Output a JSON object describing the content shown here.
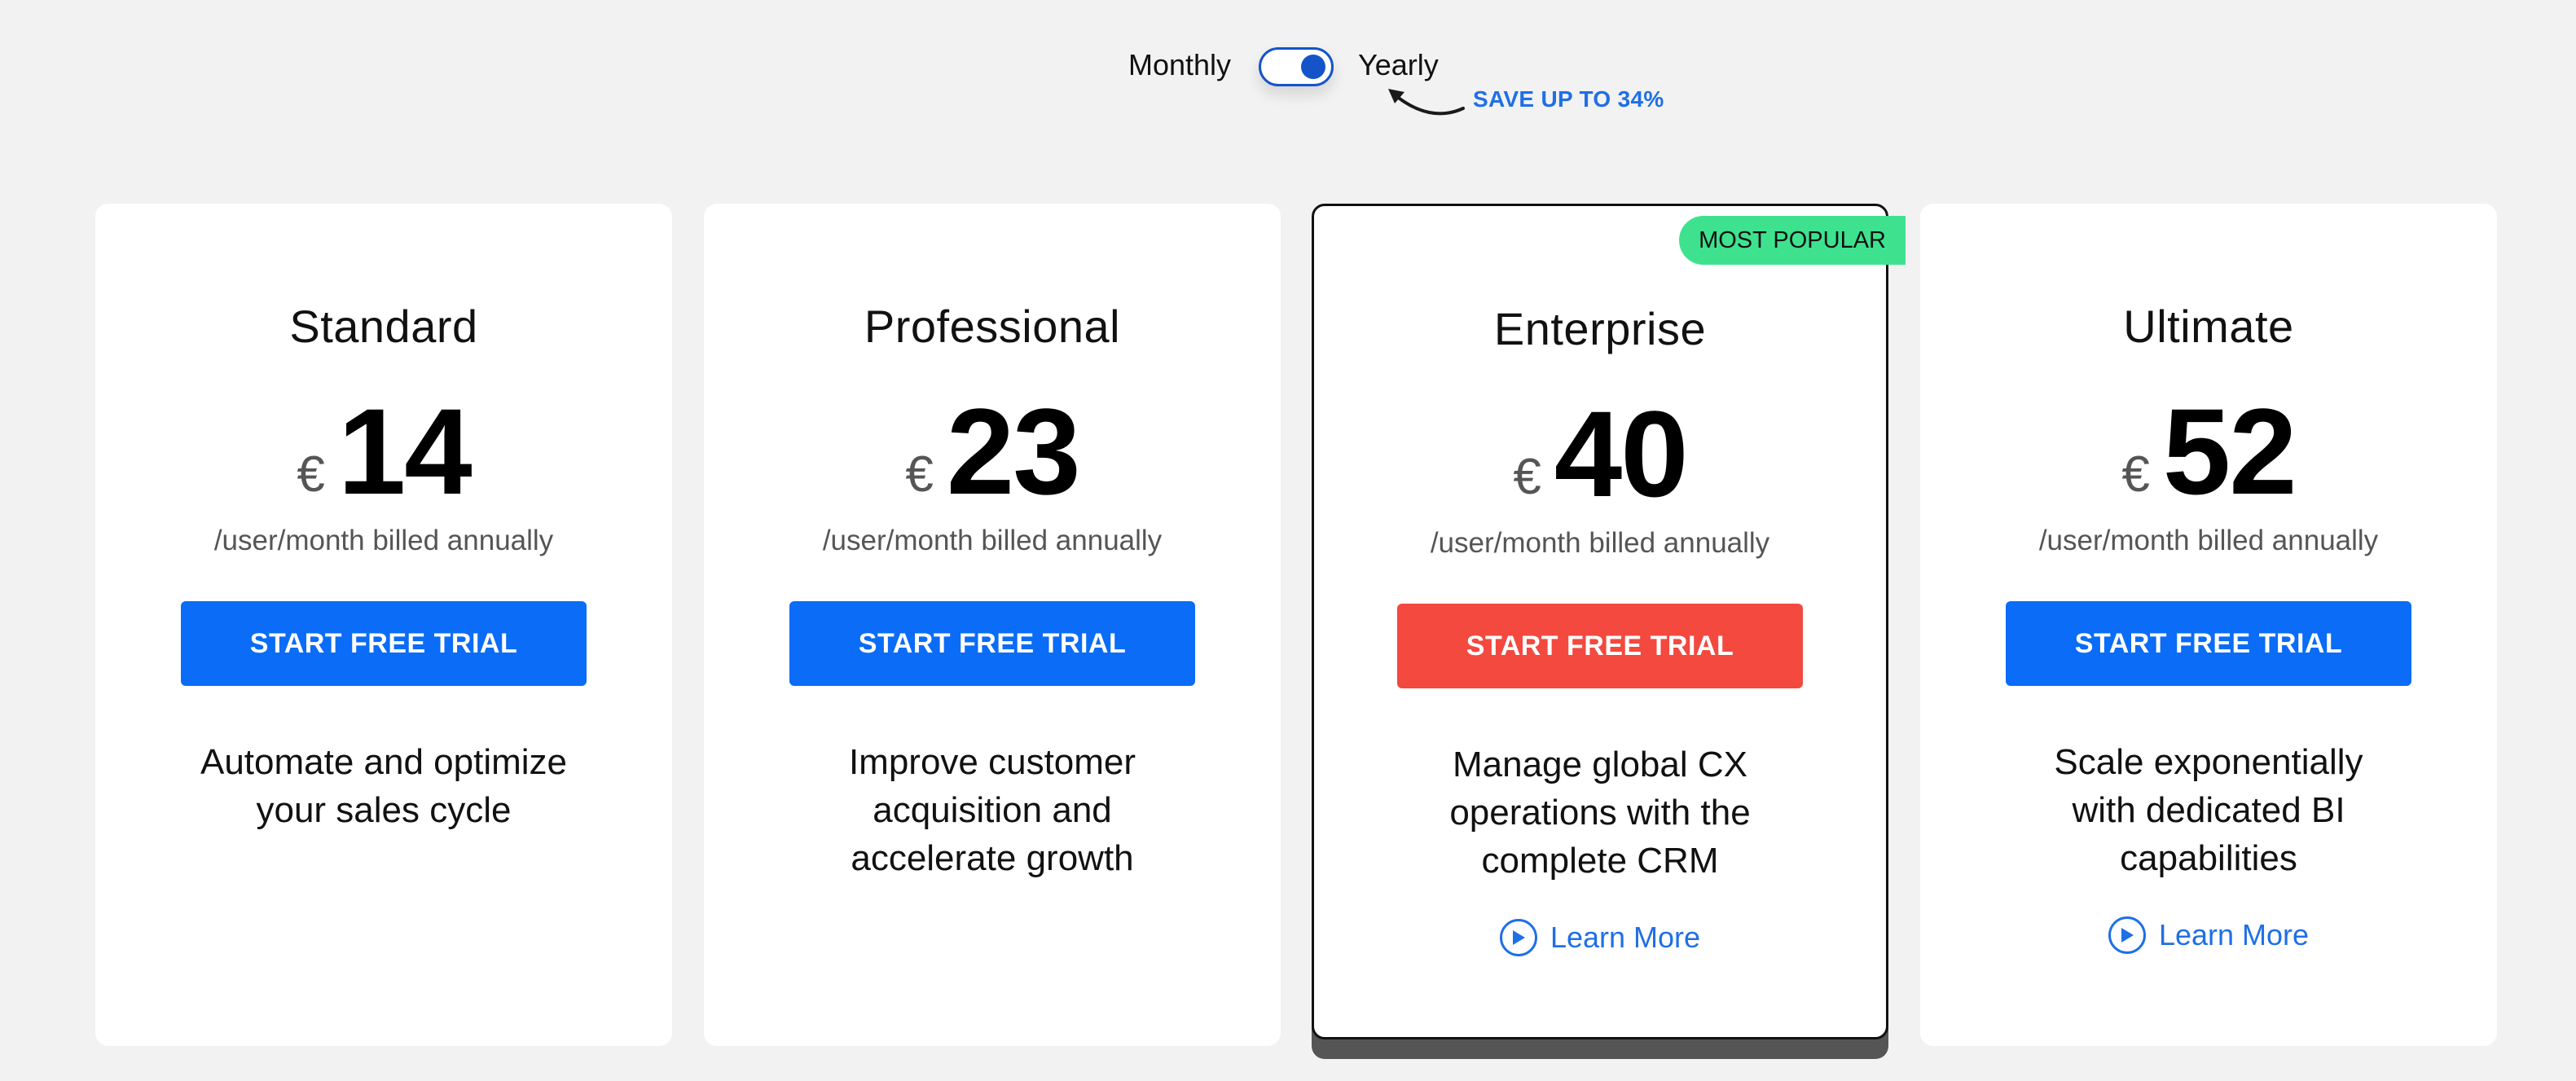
{
  "billing": {
    "monthly_label": "Monthly",
    "yearly_label": "Yearly",
    "selected": "Yearly",
    "save_text": "SAVE UP TO 34%"
  },
  "colors": {
    "primary": "#0a6cf7",
    "cta_popular": "#f3493f",
    "badge": "#3ee28e",
    "link": "#1f6fe6"
  },
  "plans": [
    {
      "name": "Standard",
      "currency": "€",
      "price": "14",
      "billing_note": "/user/month billed annually",
      "cta": "START FREE TRIAL",
      "description": "Automate and optimize your sales cycle"
    },
    {
      "name": "Professional",
      "currency": "€",
      "price": "23",
      "billing_note": "/user/month billed annually",
      "cta": "START FREE TRIAL",
      "description": "Improve customer acquisition and accelerate growth"
    },
    {
      "name": "Enterprise",
      "badge": "MOST POPULAR",
      "currency": "€",
      "price": "40",
      "billing_note": "/user/month billed annually",
      "cta": "START FREE TRIAL",
      "description": "Manage global CX operations with the complete CRM",
      "link": "Learn More",
      "link_icon": "play-circle-icon"
    },
    {
      "name": "Ultimate",
      "currency": "€",
      "price": "52",
      "billing_note": "/user/month billed annually",
      "cta": "START FREE TRIAL",
      "description": "Scale exponentially with dedicated BI capabilities",
      "link": "Learn More",
      "link_icon": "play-circle-icon"
    }
  ]
}
